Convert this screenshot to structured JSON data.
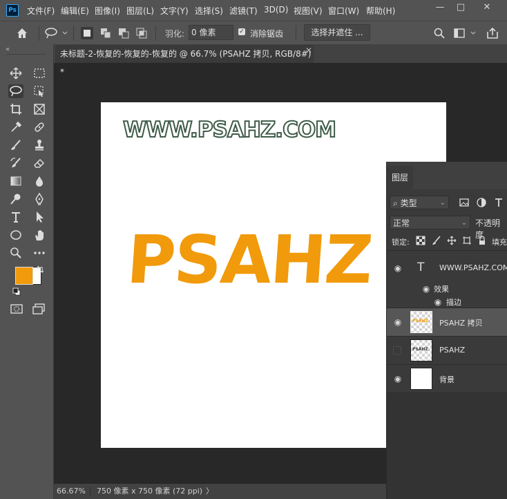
{
  "app": {
    "logo_text": "Ps",
    "menu": [
      "文件(F)",
      "编辑(E)",
      "图像(I)",
      "图层(L)",
      "文字(Y)",
      "选择(S)",
      "滤镜(T)",
      "3D(D)",
      "视图(V)",
      "窗口(W)",
      "帮助(H)"
    ],
    "window_controls": [
      "—",
      "□",
      "✕"
    ]
  },
  "options": {
    "feather_label": "羽化:",
    "feather_value": "0 像素",
    "antialias_label": "消除锯齿",
    "select_and_mask": "选择并遮住 ..."
  },
  "document": {
    "tab_title": "未标题-2-恢复的-恢复的-恢复的 @ 66.7% (PSAHZ 拷贝, RGB/8#) *",
    "canvas_text_small": "WWW.PSAHZ.COM",
    "canvas_text_big": "PSAHZ"
  },
  "status": {
    "zoom": "66.67%",
    "doc_size": "750 像素 x 750 像素 (72 ppi)",
    "arrow": "〉"
  },
  "colors": {
    "foreground": "#f19a0b",
    "background": "#ffffff",
    "accent_text": "#f19a0b"
  },
  "layers_panel": {
    "tab_label": "图层",
    "filter_label": "类型",
    "blend_mode": "正常",
    "opacity_label": "不透明度",
    "lock_label": "锁定:",
    "fill_label": "填充",
    "layers": [
      {
        "name": "WWW.PSAHZ.COM",
        "kind": "text",
        "visible": true
      },
      {
        "name": "效果",
        "kind": "effect-group",
        "visible": true
      },
      {
        "name": "描边",
        "kind": "effect",
        "visible": true
      },
      {
        "name": "PSAHZ 拷贝",
        "kind": "pixel",
        "visible": true,
        "selected": true
      },
      {
        "name": "PSAHZ",
        "kind": "pixel",
        "visible": false
      },
      {
        "name": "背景",
        "kind": "background",
        "visible": true
      }
    ],
    "text_layer_glyph": "T",
    "thumb_text": "PSAHZ"
  }
}
